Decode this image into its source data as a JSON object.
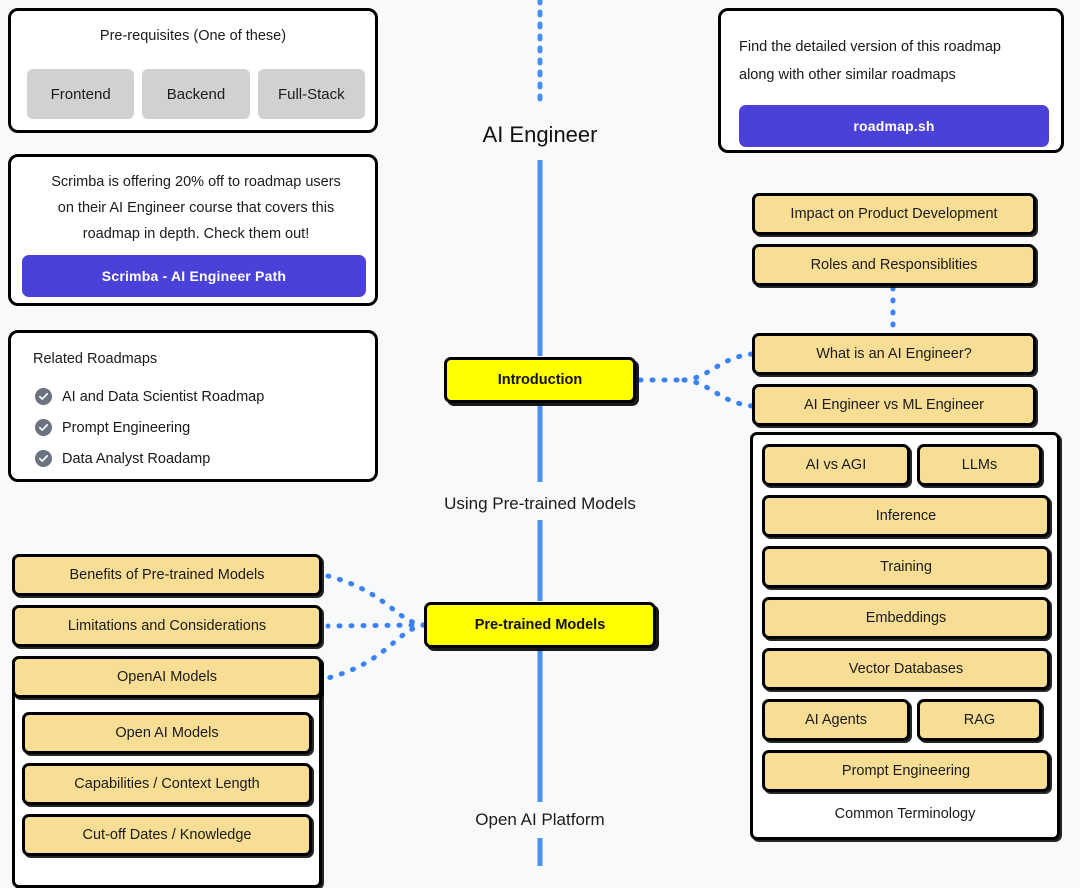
{
  "page": {
    "title": "AI Engineer",
    "background_color": "#f8f9fb",
    "node_color": "#f8de94",
    "primary_node_color": "#ffff00",
    "accent_color": "#4a42d8",
    "spine_color": "#4a90f0"
  },
  "prerequisites_card": {
    "heading": "Pre-requisites (One of these)",
    "options": [
      {
        "label": "Frontend"
      },
      {
        "label": "Backend"
      },
      {
        "label": "Full-Stack"
      }
    ]
  },
  "promo_card": {
    "text_line1": "Scrimba is offering 20% off to roadmap users",
    "text_line2": "on their AI Engineer course that covers this",
    "text_line3": "roadmap in depth. Check them out!",
    "button_label": "Scrimba - AI Engineer Path"
  },
  "related_card": {
    "heading": "Related Roadmaps",
    "items": [
      {
        "label": "AI and Data Scientist Roadmap",
        "icon": "check-circle-icon"
      },
      {
        "label": "Prompt Engineering",
        "icon": "check-circle-icon"
      },
      {
        "label": "Data Analyst Roadamp",
        "icon": "check-circle-icon"
      }
    ]
  },
  "detailed_card": {
    "text_line1": "Find the detailed version of this roadmap",
    "text_line2": "along with other similar roadmaps",
    "button_label": "roadmap.sh"
  },
  "spine": {
    "sections": [
      {
        "label": "Using Pre-trained Models"
      },
      {
        "label": "Open AI Platform"
      }
    ]
  },
  "introduction": {
    "node_label": "Introduction",
    "children": [
      {
        "label": "Impact on Product Development"
      },
      {
        "label": "Roles and Responsiblities"
      },
      {
        "label": "What is an AI Engineer?"
      },
      {
        "label": "AI Engineer vs ML Engineer"
      }
    ]
  },
  "common_terminology": {
    "group_label": "Common Terminology",
    "items": [
      {
        "label": "AI vs AGI"
      },
      {
        "label": "LLMs"
      },
      {
        "label": "Inference"
      },
      {
        "label": "Training"
      },
      {
        "label": "Embeddings"
      },
      {
        "label": "Vector Databases"
      },
      {
        "label": "AI Agents"
      },
      {
        "label": "RAG"
      },
      {
        "label": "Prompt Engineering"
      }
    ]
  },
  "pretrained_models": {
    "node_label": "Pre-trained Models",
    "children": [
      {
        "label": "Benefits of Pre-trained Models"
      },
      {
        "label": "Limitations and Considerations"
      },
      {
        "label": "OpenAI Models"
      }
    ],
    "openai_group": [
      {
        "label": "Open AI Models"
      },
      {
        "label": "Capabilities / Context Length"
      },
      {
        "label": "Cut-off Dates / Knowledge"
      }
    ]
  }
}
